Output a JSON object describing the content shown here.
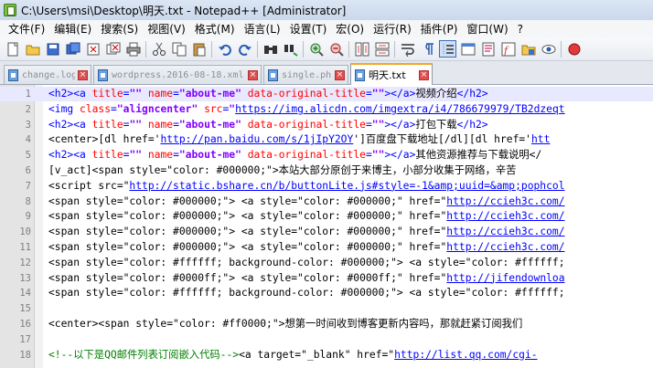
{
  "window": {
    "title": "C:\\Users\\msi\\Desktop\\明天.txt - Notepad++ [Administrator]"
  },
  "menu": [
    "文件(F)",
    "编辑(E)",
    "搜索(S)",
    "视图(V)",
    "格式(M)",
    "语言(L)",
    "设置(T)",
    "宏(O)",
    "运行(R)",
    "插件(P)",
    "窗口(W)",
    "?"
  ],
  "toolbar": {
    "icons": [
      "new-file-icon",
      "open-file-icon",
      "save-icon",
      "save-all-icon",
      "close-icon",
      "close-all-icon",
      "print-icon",
      "cut-icon",
      "copy-icon",
      "paste-icon",
      "undo-icon",
      "redo-icon",
      "find-icon",
      "replace-icon",
      "zoom-in-icon",
      "zoom-out-icon",
      "sync-vertical-icon",
      "sync-horizontal-icon",
      "word-wrap-icon",
      "show-all-chars-icon",
      "indent-guide-icon",
      "user-language-icon",
      "document-map-icon",
      "function-list-icon",
      "folder-workspace-icon",
      "monitor-icon",
      "record-macro-icon"
    ],
    "active_icon": "indent-guide-icon"
  },
  "tabs": [
    {
      "label": "change.log",
      "active": false
    },
    {
      "label": "wordpress.2016-08-18.xml",
      "active": false
    },
    {
      "label": "single.php",
      "active": false
    },
    {
      "label": "明天.txt",
      "active": true
    }
  ],
  "editor": {
    "current_line": 1,
    "lines": [
      {
        "n": "1",
        "t": [
          [
            "tag",
            "<h2><a "
          ],
          [
            "attr",
            "title"
          ],
          [
            "tag",
            "="
          ],
          [
            "str",
            "\"\""
          ],
          [
            "tag",
            " "
          ],
          [
            "attr",
            "name"
          ],
          [
            "tag",
            "="
          ],
          [
            "str",
            "\"about-me\""
          ],
          [
            "tag",
            " "
          ],
          [
            "attr",
            "data-original-title"
          ],
          [
            "tag",
            "="
          ],
          [
            "str",
            "\"\""
          ],
          [
            "tag",
            "></a>"
          ],
          [
            "txt",
            "视频介绍"
          ],
          [
            "tag",
            "</h2>"
          ]
        ]
      },
      {
        "n": "2",
        "t": [
          [
            "tag",
            "<img "
          ],
          [
            "attr",
            "class"
          ],
          [
            "tag",
            "="
          ],
          [
            "str",
            "\"aligncenter\""
          ],
          [
            "tag",
            " "
          ],
          [
            "attr",
            "src"
          ],
          [
            "tag",
            "="
          ],
          [
            "str",
            "\""
          ],
          [
            "url",
            "https://img.alicdn.com/imgextra/i4/786679979/TB2dzeqt"
          ]
        ]
      },
      {
        "n": "3",
        "t": [
          [
            "tag",
            "<h2><a "
          ],
          [
            "attr",
            "title"
          ],
          [
            "tag",
            "="
          ],
          [
            "str",
            "\"\""
          ],
          [
            "tag",
            " "
          ],
          [
            "attr",
            "name"
          ],
          [
            "tag",
            "="
          ],
          [
            "str",
            "\"about-me\""
          ],
          [
            "tag",
            " "
          ],
          [
            "attr",
            "data-original-title"
          ],
          [
            "tag",
            "="
          ],
          [
            "str",
            "\"\""
          ],
          [
            "tag",
            "></a>"
          ],
          [
            "txt",
            "打包下载"
          ],
          [
            "tag",
            "</h2>"
          ]
        ]
      },
      {
        "n": "4",
        "t": [
          [
            "txt",
            "<center>[dl href='"
          ],
          [
            "url",
            "http://pan.baidu.com/s/1jIpY2OY"
          ],
          [
            "txt",
            "']百度盘下载地址[/dl][dl href='"
          ],
          [
            "url",
            "htt"
          ]
        ]
      },
      {
        "n": "5",
        "t": [
          [
            "tag",
            "<h2><a "
          ],
          [
            "attr",
            "title"
          ],
          [
            "tag",
            "="
          ],
          [
            "str",
            "\"\""
          ],
          [
            "tag",
            " "
          ],
          [
            "attr",
            "name"
          ],
          [
            "tag",
            "="
          ],
          [
            "str",
            "\"about-me\""
          ],
          [
            "tag",
            " "
          ],
          [
            "attr",
            "data-original-title"
          ],
          [
            "tag",
            "="
          ],
          [
            "str",
            "\"\""
          ],
          [
            "tag",
            "></a>"
          ],
          [
            "txt",
            "其他资源推荐与下载说明</"
          ]
        ]
      },
      {
        "n": "6",
        "t": [
          [
            "txt",
            "[v_act]<span style=\"color: #000000;\">本站大部分原创于来博主，小部分收集于网络，辛苦"
          ]
        ]
      },
      {
        "n": "7",
        "t": [
          [
            "txt",
            "<script src=\""
          ],
          [
            "url",
            "http://static.bshare.cn/b/buttonLite.js#style=-1&amp;uuid=&amp;pophcol"
          ]
        ]
      },
      {
        "n": "8",
        "t": [
          [
            "txt",
            "<span style=\"color: #000000;\"> <a style=\"color: #000000;\" href=\""
          ],
          [
            "url",
            "http://ccieh3c.com/"
          ]
        ]
      },
      {
        "n": "9",
        "t": [
          [
            "txt",
            "<span style=\"color: #000000;\"> <a style=\"color: #000000;\" href=\""
          ],
          [
            "url",
            "http://ccieh3c.com/"
          ]
        ]
      },
      {
        "n": "10",
        "t": [
          [
            "txt",
            "<span style=\"color: #000000;\"> <a style=\"color: #000000;\" href=\""
          ],
          [
            "url",
            "http://ccieh3c.com/"
          ]
        ]
      },
      {
        "n": "11",
        "t": [
          [
            "txt",
            "<span style=\"color: #000000;\"> <a style=\"color: #000000;\" href=\""
          ],
          [
            "url",
            "http://ccieh3c.com/"
          ]
        ]
      },
      {
        "n": "12",
        "t": [
          [
            "txt",
            "<span style=\"color: #ffffff; background-color: #000000;\"> <a style=\"color: #ffffff;"
          ]
        ]
      },
      {
        "n": "13",
        "t": [
          [
            "txt",
            "<span style=\"color: #0000ff;\"> <a style=\"color: #0000ff;\" href=\""
          ],
          [
            "url",
            "http://jifendownloa"
          ]
        ]
      },
      {
        "n": "14",
        "t": [
          [
            "txt",
            "<span style=\"color: #ffffff; background-color: #000000;\"> <a style=\"color: #ffffff;"
          ]
        ]
      },
      {
        "n": "15",
        "t": []
      },
      {
        "n": "16",
        "t": [
          [
            "txt",
            "<center><span style=\"color: #ff0000;\">想第一时间收到博客更新内容吗，那就赶紧订阅我们"
          ]
        ]
      },
      {
        "n": "17",
        "t": []
      },
      {
        "n": "18",
        "t": [
          [
            "cmt",
            "<!--以下是QQ邮件列表订阅嵌入代码-->"
          ],
          [
            "txt",
            "<a target=\"_blank\" href=\""
          ],
          [
            "url",
            "http://list.qq.com/cgi-"
          ]
        ]
      }
    ]
  }
}
